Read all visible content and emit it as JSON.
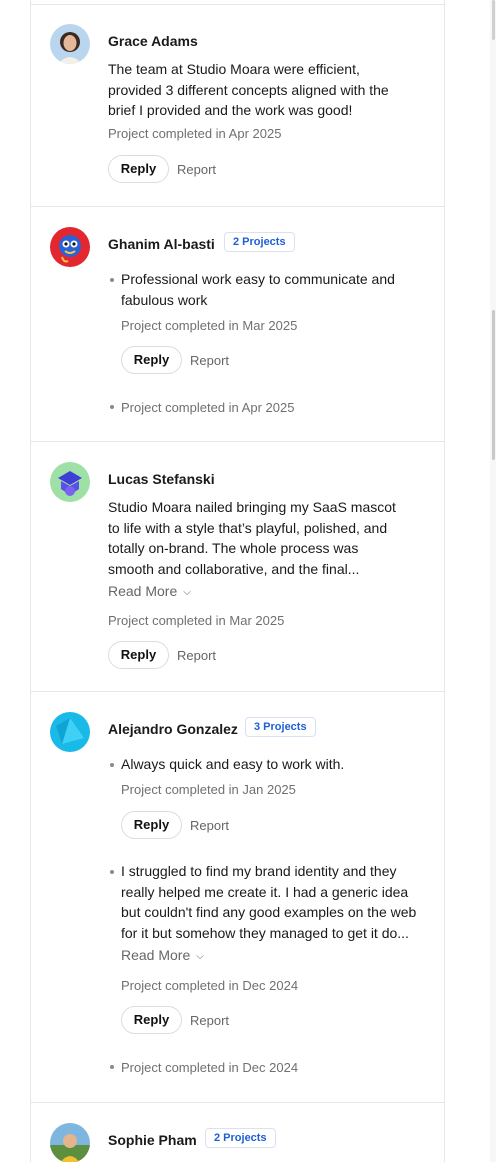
{
  "reviews": [
    {
      "name": "Grace Adams",
      "text": "The team at Studio Moara were efficient, provided 3 different concepts aligned with the brief I provided and the work was good!",
      "completed": "Project completed in Apr 2025",
      "reply": "Reply",
      "report": "Report"
    },
    {
      "name": "Ghanim Al-basti",
      "badge": "2 Projects",
      "items": [
        {
          "text": "Professional work easy to communicate and fabulous work",
          "completed": "Project completed in Mar 2025",
          "reply": "Reply",
          "report": "Report"
        },
        {
          "completed": "Project completed in Apr 2025"
        }
      ]
    },
    {
      "name": "Lucas Stefanski",
      "text": "Studio Moara nailed bringing my SaaS mascot to life with a style that’s playful, polished, and totally on-brand. The whole process was smooth and collaborative, and the final...",
      "read_more": "Read More",
      "completed": "Project completed in Mar 2025",
      "reply": "Reply",
      "report": "Report"
    },
    {
      "name": "Alejandro Gonzalez",
      "badge": "3 Projects",
      "items": [
        {
          "text": "Always quick and easy to work with.",
          "completed": "Project completed in Jan 2025",
          "reply": "Reply",
          "report": "Report"
        },
        {
          "text": "I struggled to find my brand identity and they really helped me create it. I had a generic idea but couldn't find any good examples on the web for it but somehow they managed to get it do...",
          "read_more": "Read More",
          "completed": "Project completed in Dec 2024",
          "reply": "Reply",
          "report": "Report"
        },
        {
          "completed": "Project completed in Dec 2024"
        }
      ]
    },
    {
      "name": "Sophie Pham",
      "badge": "2 Projects"
    }
  ]
}
